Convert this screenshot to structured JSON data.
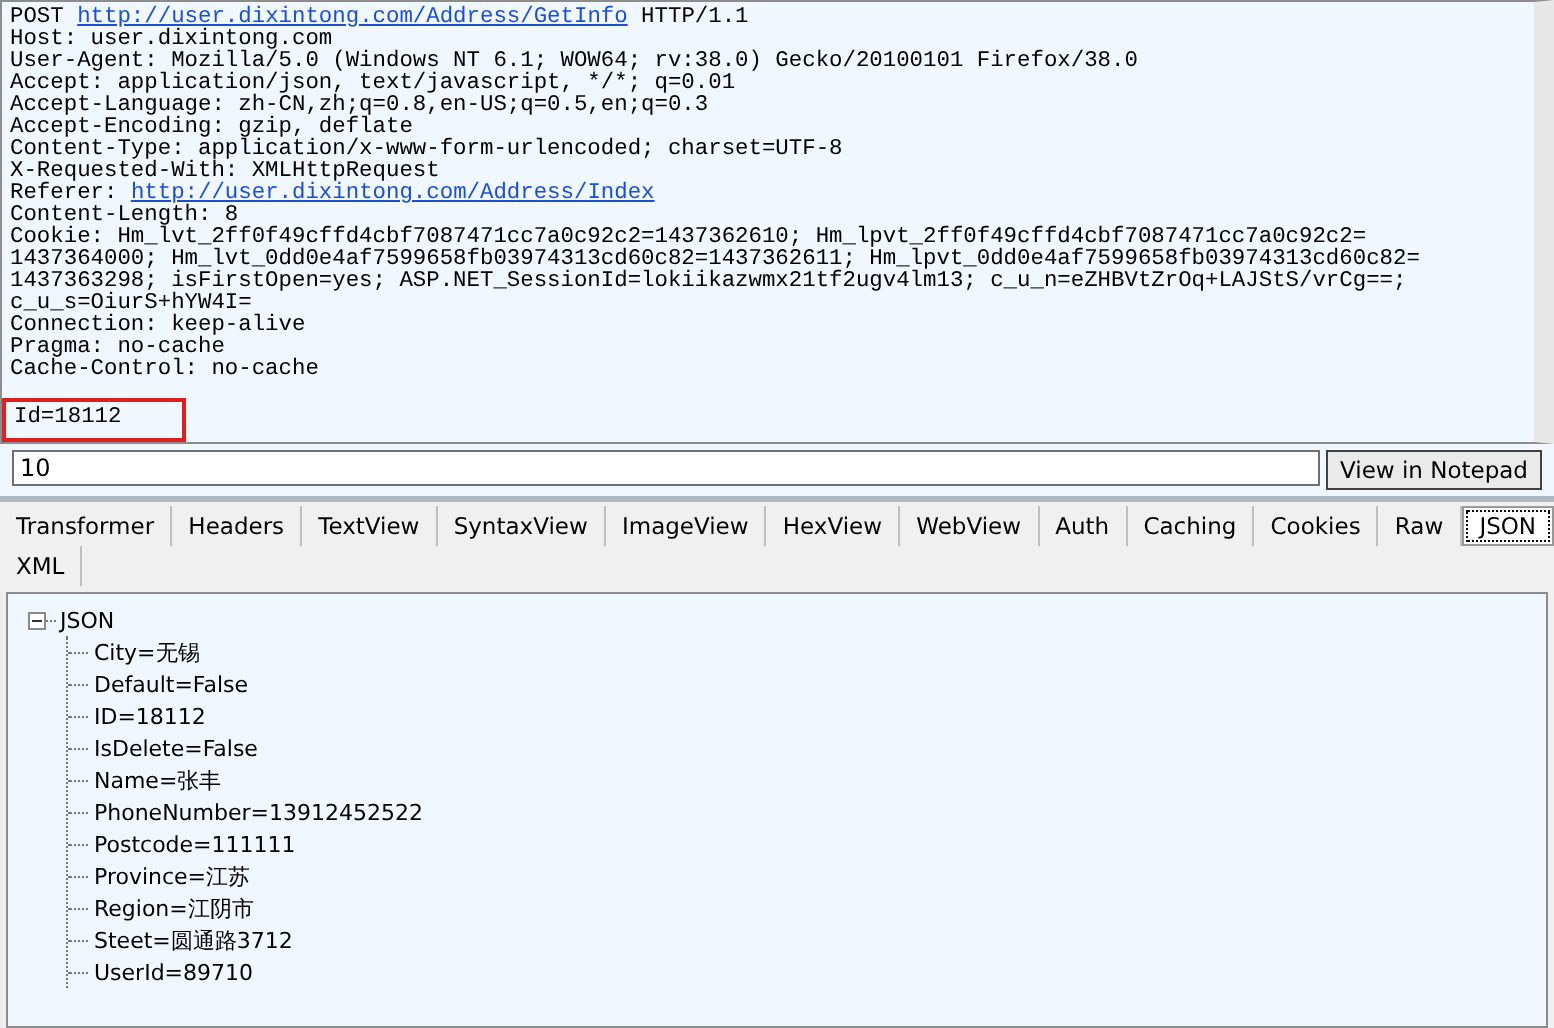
{
  "request": {
    "lines": [
      {
        "kind": "link",
        "prefix": "POST ",
        "link": "http://user.dixintong.com/Address/GetInfo",
        "suffix": " HTTP/1.1"
      },
      {
        "kind": "plain",
        "text": "Host: user.dixintong.com"
      },
      {
        "kind": "plain",
        "text": "User-Agent: Mozilla/5.0 (Windows NT 6.1; WOW64; rv:38.0) Gecko/20100101 Firefox/38.0"
      },
      {
        "kind": "plain",
        "text": "Accept: application/json, text/javascript, */*; q=0.01"
      },
      {
        "kind": "plain",
        "text": "Accept-Language: zh-CN,zh;q=0.8,en-US;q=0.5,en;q=0.3"
      },
      {
        "kind": "plain",
        "text": "Accept-Encoding: gzip, deflate"
      },
      {
        "kind": "plain",
        "text": "Content-Type: application/x-www-form-urlencoded; charset=UTF-8"
      },
      {
        "kind": "plain",
        "text": "X-Requested-With: XMLHttpRequest"
      },
      {
        "kind": "link",
        "prefix": "Referer: ",
        "link": "http://user.dixintong.com/Address/Index"
      },
      {
        "kind": "plain",
        "text": "Content-Length: 8"
      },
      {
        "kind": "plain",
        "text": "Cookie: Hm_lvt_2ff0f49cffd4cbf7087471cc7a0c92c2=1437362610; Hm_lpvt_2ff0f49cffd4cbf7087471cc7a0c92c2="
      },
      {
        "kind": "plain",
        "text": "1437364000; Hm_lvt_0dd0e4af7599658fb03974313cd60c82=1437362611; Hm_lpvt_0dd0e4af7599658fb03974313cd60c82="
      },
      {
        "kind": "plain",
        "text": "1437363298; isFirstOpen=yes; ASP.NET_SessionId=lokiikazwmx21tf2ugv4lm13; c_u_n=eZHBVtZrOq+LAJStS/vrCg==;"
      },
      {
        "kind": "plain",
        "text": "c_u_s=OiurS+hYW4I="
      },
      {
        "kind": "plain",
        "text": "Connection: keep-alive"
      },
      {
        "kind": "plain",
        "text": "Pragma: no-cache"
      },
      {
        "kind": "plain",
        "text": "Cache-Control: no-cache"
      }
    ],
    "body": {
      "text": "Id=18112",
      "highlighted": true
    }
  },
  "find_field": {
    "value": "10"
  },
  "notepad_button": "View in Notepad",
  "tabs": [
    {
      "label": "Transformer",
      "selected": false
    },
    {
      "label": "Headers",
      "selected": false
    },
    {
      "label": "TextView",
      "selected": false
    },
    {
      "label": "SyntaxView",
      "selected": false
    },
    {
      "label": "ImageView",
      "selected": false
    },
    {
      "label": "HexView",
      "selected": false
    },
    {
      "label": "WebView",
      "selected": false
    },
    {
      "label": "Auth",
      "selected": false
    },
    {
      "label": "Caching",
      "selected": false
    },
    {
      "label": "Cookies",
      "selected": false
    },
    {
      "label": "Raw",
      "selected": false
    },
    {
      "label": "JSON",
      "selected": true
    },
    {
      "label": "XML",
      "selected": false
    }
  ],
  "tree": {
    "label": "JSON",
    "expanded": true,
    "children": [
      {
        "label": "City=无锡"
      },
      {
        "label": "Default=False"
      },
      {
        "label": "ID=18112"
      },
      {
        "label": "IsDelete=False"
      },
      {
        "label": "Name=张丰"
      },
      {
        "label": "PhoneNumber=13912452522"
      },
      {
        "label": "Postcode=111111"
      },
      {
        "label": "Province=江苏"
      },
      {
        "label": "Region=江阴市"
      },
      {
        "label": "Steet=圆通路3712"
      },
      {
        "label": "UserId=89710"
      }
    ]
  }
}
